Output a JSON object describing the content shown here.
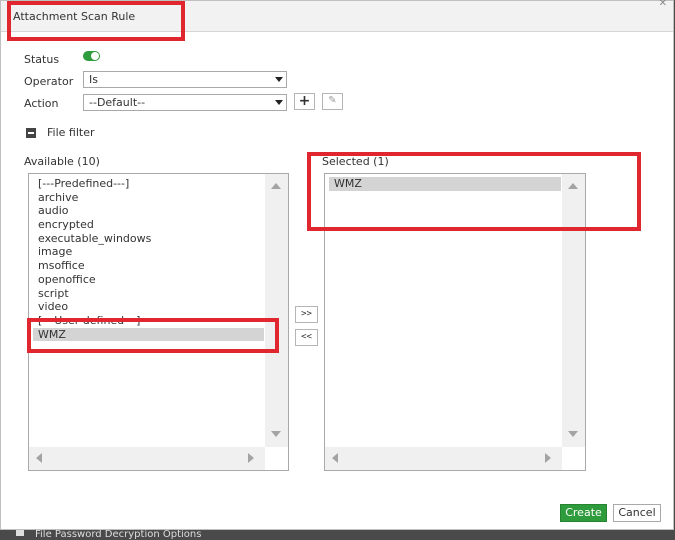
{
  "dialog": {
    "title": "Attachment Scan Rule"
  },
  "form": {
    "status_label": "Status",
    "status_on": true,
    "operator_label": "Operator",
    "operator_value": "Is",
    "action_label": "Action",
    "action_value": "--Default--"
  },
  "file_filter": {
    "section_title": "File filter",
    "available_label": "Available (10)",
    "selected_label": "Selected (1)",
    "available_items": [
      "[---Predefined---]",
      "archive",
      "audio",
      "encrypted",
      "executable_windows",
      "image",
      "msoffice",
      "openoffice",
      "script",
      "video",
      "[---User defined---]",
      "WMZ"
    ],
    "selected_items": [
      "WMZ"
    ],
    "add_label": ">>",
    "remove_label": "<<"
  },
  "footer": {
    "create_label": "Create",
    "cancel_label": "Cancel"
  },
  "background": {
    "behind_text": "File Password Decryption Options"
  },
  "colors": {
    "accent_green": "#2e9b3c",
    "highlight_red": "#e0262f",
    "selection_gray": "#d4d4d4"
  }
}
